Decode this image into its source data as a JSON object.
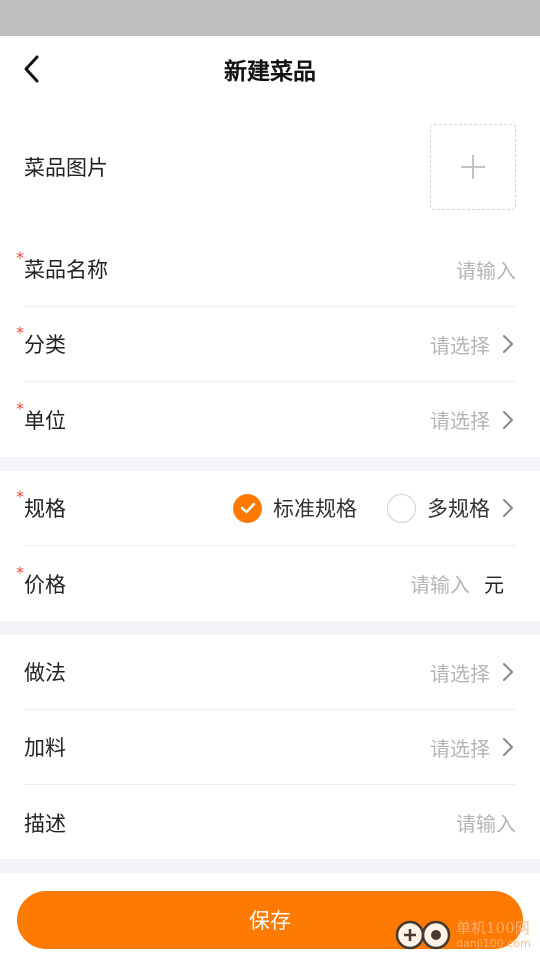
{
  "header": {
    "title": "新建菜品"
  },
  "photo": {
    "label": "菜品图片"
  },
  "basic": {
    "name": {
      "label": "菜品名称",
      "placeholder": "请输入"
    },
    "category": {
      "label": "分类",
      "placeholder": "请选择"
    },
    "unit": {
      "label": "单位",
      "placeholder": "请选择"
    }
  },
  "spec": {
    "label": "规格",
    "options": [
      {
        "label": "标准规格",
        "selected": true
      },
      {
        "label": "多规格",
        "selected": false
      }
    ]
  },
  "price": {
    "label": "价格",
    "placeholder": "请输入",
    "unit": "元"
  },
  "extra": {
    "method": {
      "label": "做法",
      "placeholder": "请选择"
    },
    "topping": {
      "label": "加料",
      "placeholder": "请选择"
    },
    "description": {
      "label": "描述",
      "placeholder": "请输入"
    }
  },
  "required_mark": "*",
  "footer": {
    "save_label": "保存"
  },
  "watermark": {
    "cn": "单机100网",
    "en": "danji100.com"
  },
  "colors": {
    "accent": "#ff7a00",
    "required": "#e94b35",
    "placeholder": "#b5b5b5",
    "divider_bg": "#f2f4f7"
  }
}
